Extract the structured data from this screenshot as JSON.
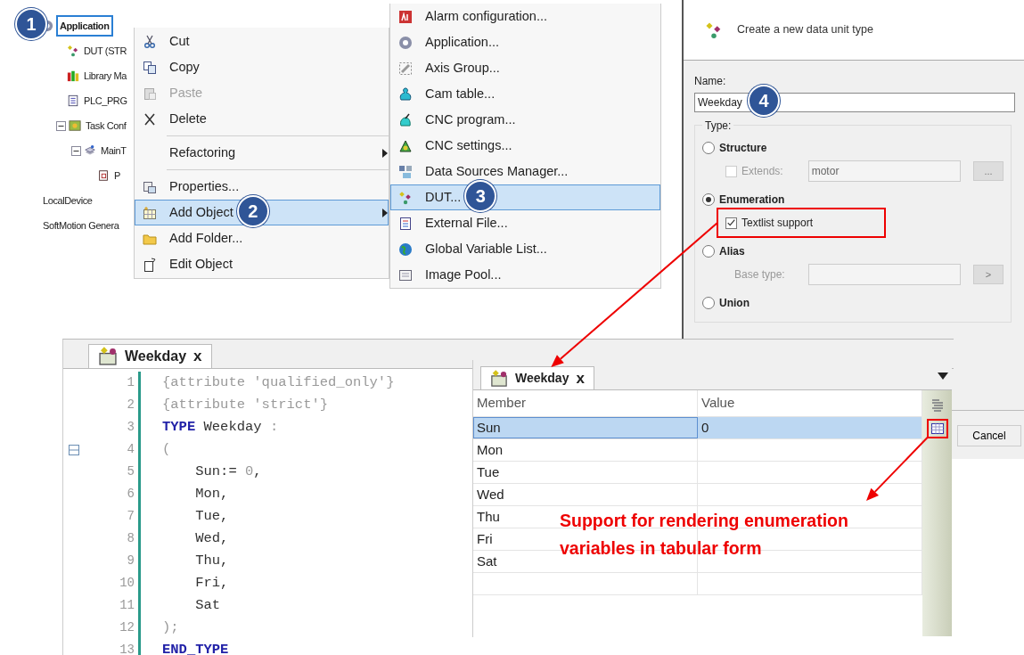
{
  "project_tree": {
    "items": [
      {
        "label": "Application",
        "selected": true,
        "badge": "1",
        "children": [
          {
            "label": "DUT (STR",
            "selected": false
          },
          {
            "label": "Library Ma",
            "selected": false
          },
          {
            "label": "PLC_PRG",
            "selected": false
          },
          {
            "label": "Task Conf",
            "selected": false,
            "expanded": true,
            "children": [
              {
                "label": "MainT",
                "selected": false,
                "expanded": true,
                "children": [
                  {
                    "label": "P",
                    "selected": false
                  }
                ]
              }
            ]
          }
        ]
      },
      {
        "label": "LocalDevice",
        "selected": false
      },
      {
        "label": "SoftMotion Genera",
        "selected": false
      }
    ]
  },
  "context_menu": {
    "items": [
      {
        "kind": "item",
        "label": "Cut",
        "disabled": false,
        "selected": false
      },
      {
        "kind": "item",
        "label": "Copy",
        "disabled": false,
        "selected": false
      },
      {
        "kind": "item",
        "label": "Paste",
        "disabled": true,
        "selected": false
      },
      {
        "kind": "item",
        "label": "Delete",
        "disabled": false,
        "selected": false
      },
      {
        "kind": "separator"
      },
      {
        "kind": "item",
        "label": "Refactoring",
        "disabled": false,
        "selected": false,
        "submenu": true
      },
      {
        "kind": "separator"
      },
      {
        "kind": "item",
        "label": "Properties...",
        "disabled": false,
        "selected": false
      },
      {
        "kind": "item",
        "label": "Add Object",
        "disabled": false,
        "selected": true,
        "submenu": true,
        "badge": "2"
      },
      {
        "kind": "item",
        "label": "Add Folder...",
        "disabled": false,
        "selected": false
      },
      {
        "kind": "item",
        "label": "Edit Object",
        "disabled": false,
        "selected": false
      }
    ]
  },
  "submenu": {
    "items": [
      {
        "label": "Alarm configuration...",
        "selected": false
      },
      {
        "label": "Application...",
        "selected": false
      },
      {
        "label": "Axis Group...",
        "selected": false
      },
      {
        "label": "Cam table...",
        "selected": false
      },
      {
        "label": "CNC program...",
        "selected": false
      },
      {
        "label": "CNC settings...",
        "selected": false
      },
      {
        "label": "Data Sources Manager...",
        "selected": false
      },
      {
        "label": "DUT...",
        "selected": true,
        "badge": "3"
      },
      {
        "label": "External File...",
        "selected": false
      },
      {
        "label": "Global Variable List...",
        "selected": false
      },
      {
        "label": "Image Pool...",
        "selected": false
      }
    ]
  },
  "dialog": {
    "header": "Create a new data unit type",
    "name_label": "Name:",
    "name_value": "Weekday",
    "name_badge": "4",
    "type_label": "Type:",
    "options": [
      {
        "label": "Structure",
        "selected": false,
        "checkbox": {
          "label": "Extends:",
          "checked": false,
          "disabled": true,
          "value": "motor",
          "button": "..."
        }
      },
      {
        "label": "Enumeration",
        "selected": true,
        "checkbox": {
          "label": "Textlist support",
          "checked": true,
          "disabled": false,
          "highlighted": true
        }
      },
      {
        "label": "Alias",
        "selected": false,
        "field": {
          "label": "Base type:",
          "button": ">"
        }
      },
      {
        "label": "Union",
        "selected": false
      }
    ],
    "cancel": "Cancel"
  },
  "editor": {
    "tab": {
      "title": "Weekday",
      "close": "x"
    },
    "lines": [
      {
        "number": "1",
        "parts": [
          {
            "text": "{attribute 'qualified_only'}",
            "kind": "pragma"
          }
        ]
      },
      {
        "number": "2",
        "parts": [
          {
            "text": "{attribute 'strict'}",
            "kind": "pragma"
          }
        ]
      },
      {
        "number": "3",
        "parts": [
          {
            "text": "TYPE",
            "kind": "keyword"
          },
          {
            "text": " Weekday ",
            "kind": "plain"
          },
          {
            "text": ":",
            "kind": "pragma"
          }
        ]
      },
      {
        "number": "4",
        "fold": true,
        "parts": [
          {
            "text": "(",
            "kind": "pragma"
          }
        ]
      },
      {
        "number": "5",
        "parts": [
          {
            "text": "    Sun:= ",
            "kind": "plain"
          },
          {
            "text": "0",
            "kind": "pragma"
          },
          {
            "text": ",",
            "kind": "plain"
          }
        ]
      },
      {
        "number": "6",
        "parts": [
          {
            "text": "    Mon,",
            "kind": "plain"
          }
        ]
      },
      {
        "number": "7",
        "parts": [
          {
            "text": "    Tue,",
            "kind": "plain"
          }
        ]
      },
      {
        "number": "8",
        "parts": [
          {
            "text": "    Wed,",
            "kind": "plain"
          }
        ]
      },
      {
        "number": "9",
        "parts": [
          {
            "text": "    Thu,",
            "kind": "plain"
          }
        ]
      },
      {
        "number": "10",
        "parts": [
          {
            "text": "    Fri,",
            "kind": "plain"
          }
        ]
      },
      {
        "number": "11",
        "parts": [
          {
            "text": "    Sat",
            "kind": "plain"
          }
        ]
      },
      {
        "number": "12",
        "parts": [
          {
            "text": ");",
            "kind": "pragma"
          }
        ]
      },
      {
        "number": "13",
        "parts": [
          {
            "text": "END_TYPE",
            "kind": "keyword"
          }
        ]
      }
    ]
  },
  "table_view": {
    "tab": {
      "title": "Weekday",
      "close": "x"
    },
    "columns": [
      "Member",
      "Value"
    ],
    "rows": [
      {
        "member": "Sun",
        "value": "0",
        "selected": true
      },
      {
        "member": "Mon",
        "selected": false
      },
      {
        "member": "Tue",
        "selected": false
      },
      {
        "member": "Wed",
        "selected": false
      },
      {
        "member": "Thu",
        "selected": false
      },
      {
        "member": "Fri",
        "selected": false
      },
      {
        "member": "Sat",
        "selected": false
      }
    ],
    "toolbar": [
      {
        "highlighted": false
      },
      {
        "highlighted": true
      }
    ]
  },
  "annotation": "Support for rendering enumeration variables in tabular form"
}
